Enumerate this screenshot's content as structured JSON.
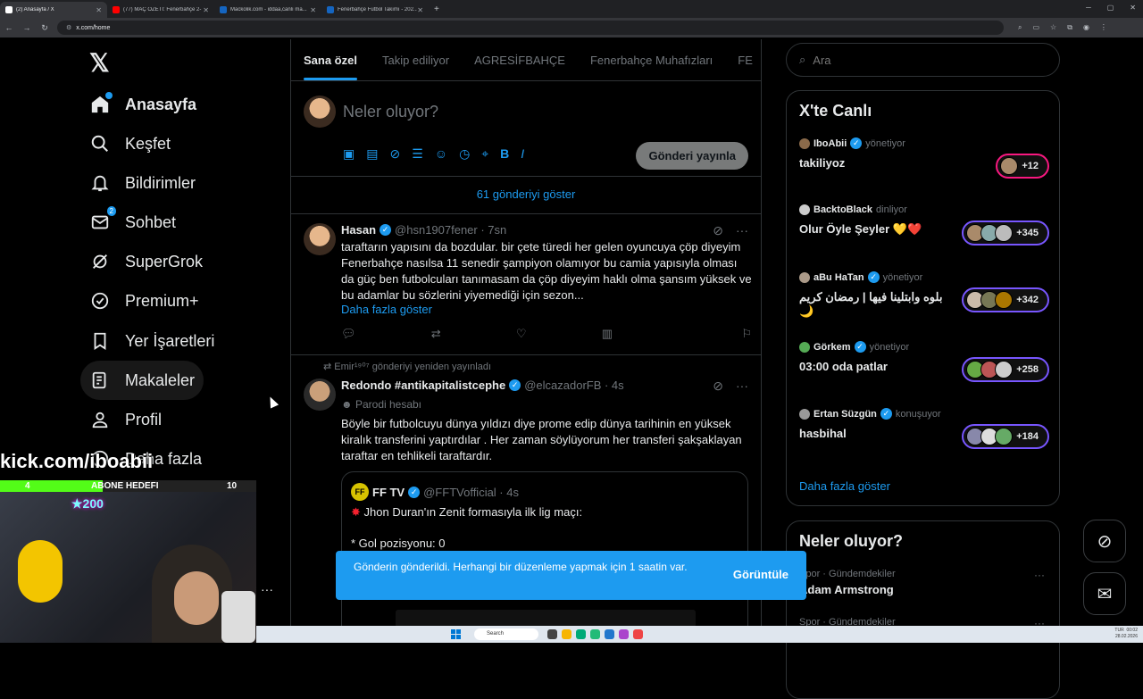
{
  "browser": {
    "tabs": [
      {
        "title": "(2) Anasayfa / X",
        "color": "#000000"
      },
      {
        "title": "(77) MAÇ ÖZETİ: Fenerbahçe 2-",
        "color": "#ff0000"
      },
      {
        "title": "Mackolik.com - iddaa,canlı ma...",
        "color": "#1565c0"
      },
      {
        "title": "Fenerbahçe Futbol Takımı - 202...",
        "color": "#1565c0"
      }
    ],
    "url": "x.com/home"
  },
  "nav": {
    "items": [
      {
        "label": "Anasayfa"
      },
      {
        "label": "Keşfet"
      },
      {
        "label": "Bildirimler"
      },
      {
        "label": "Sohbet",
        "badge": "2"
      },
      {
        "label": "SuperGrok"
      },
      {
        "label": "Premium+"
      },
      {
        "label": "Yer İşaretleri"
      },
      {
        "label": "Makaleler"
      },
      {
        "label": "Profil"
      },
      {
        "label": "Daha fazla"
      }
    ]
  },
  "feed": {
    "tabs": [
      "Sana özel",
      "Takip ediliyor",
      "AGRESİFBAHÇE",
      "Fenerbahçe Muhafızları",
      "FE"
    ],
    "compose_placeholder": "Neler oluyor?",
    "post_button": "Gönderi yayınla",
    "show_new": "61 gönderiyi göster",
    "tweet1": {
      "name": "Hasan",
      "handle": "@hsn1907fener · 7sn",
      "text": "taraftarın yapısını da bozdular. bir çete türedi her gelen oyuncuya çöp diyeyim Fenerbahçe nasılsa 11 senedir şampiyon olamıyor bu camia yapısıyla olması da güç ben futbolcuları tanımasam da çöp diyeyim haklı olma şansım yüksek ve bu adamlar bu sözlerini yiyemediği için sezon...",
      "more": "Daha fazla göster"
    },
    "tweet2": {
      "retweet_line": "Emir¹⁹⁰⁷ gönderiyi yeniden yayınladı",
      "name": "Redondo #antikapitalistcephe",
      "handle": "@elcazadorFB · 4s",
      "parody": "Parodi hesabı",
      "text": "Böyle bir futbolcuyu dünya yıldızı diye prome edip dünya tarihinin en yüksek kiralık transferini yaptırdılar . Her zaman söylüyorum her transferi şakşaklayan taraftar en tehlikeli taraftardır.",
      "quote": {
        "logo": "FF",
        "name": "FF TV",
        "handle": "@FFTVofficial · 4s",
        "line1": "Jhon Duran'ın Zenit formasıyla ilk lig maçı:",
        "line2": "* Gol pozisyonu: 0"
      }
    }
  },
  "toast": {
    "message": "Gönderin gönderildi. Herhangi bir düzenleme yapmak için 1 saatin var.",
    "action": "Görüntüle"
  },
  "sidebar": {
    "search_placeholder": "Ara",
    "live_title": "X'te Canlı",
    "live": [
      {
        "host": "IboAbii",
        "role": "yönetiyor",
        "title": "takiliyoz",
        "count": "+12"
      },
      {
        "host": "BacktoBlack",
        "role": "dinliyor",
        "title": "Olur Öyle Şeyler 💛❤️",
        "count": "+345"
      },
      {
        "host": "aBu HaTan",
        "role": "yönetiyor",
        "title": "بلوه وابتلينا فيها | رمضان كريم 🌙",
        "count": "+342"
      },
      {
        "host": "Görkem",
        "role": "yönetiyor",
        "title": "03:00 oda patlar",
        "count": "+258"
      },
      {
        "host": "Ertan Süzgün",
        "role": "konuşuyor",
        "title": "hasbihal",
        "count": "+184"
      }
    ],
    "live_more": "Daha fazla göster",
    "whats_title": "Neler oluyor?",
    "trends": [
      {
        "meta": "Spor · Gündemdekiler",
        "title": "Adam Armstrong"
      },
      {
        "meta": "Spor · Gündemdekiler",
        "title": ""
      }
    ]
  },
  "stream": {
    "kick": "kick.com/iboabii",
    "sub_left": "4",
    "sub_label": "ABONE HEDEFI",
    "sub_right": "10",
    "sub_progress": 0.4
  },
  "taskbar": {
    "search": "Search",
    "lang": "TUR",
    "time": "00:02",
    "date": "28.02.2026"
  }
}
